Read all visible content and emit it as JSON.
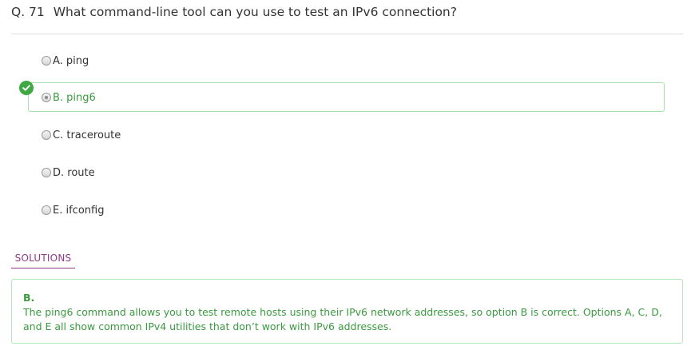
{
  "question": {
    "number": "Q. 71",
    "text": "What command-line tool can you use to test an IPv6 connection?"
  },
  "options": [
    {
      "label": "A. ping",
      "selected": false,
      "correct": false
    },
    {
      "label": "B. ping6",
      "selected": true,
      "correct": true
    },
    {
      "label": "C. traceroute",
      "selected": false,
      "correct": false
    },
    {
      "label": "D. route",
      "selected": false,
      "correct": false
    },
    {
      "label": "E. ifconfig",
      "selected": false,
      "correct": false
    }
  ],
  "solutions": {
    "tab_label": "SOLUTIONS",
    "answer": "B.",
    "explanation": "The ping6 command allows you to test remote hosts using their IPv6 network addresses, so option B is correct. Options A, C, D, and E all show common IPv4 utilities that don’t work with IPv6 addresses."
  },
  "icons": {
    "correct_marker": "check-circle-icon"
  },
  "colors": {
    "correct_green": "#3ea843",
    "correct_text": "#3a9a3f",
    "solutions_accent": "#8e3a8a",
    "divider": "#dddddd"
  }
}
